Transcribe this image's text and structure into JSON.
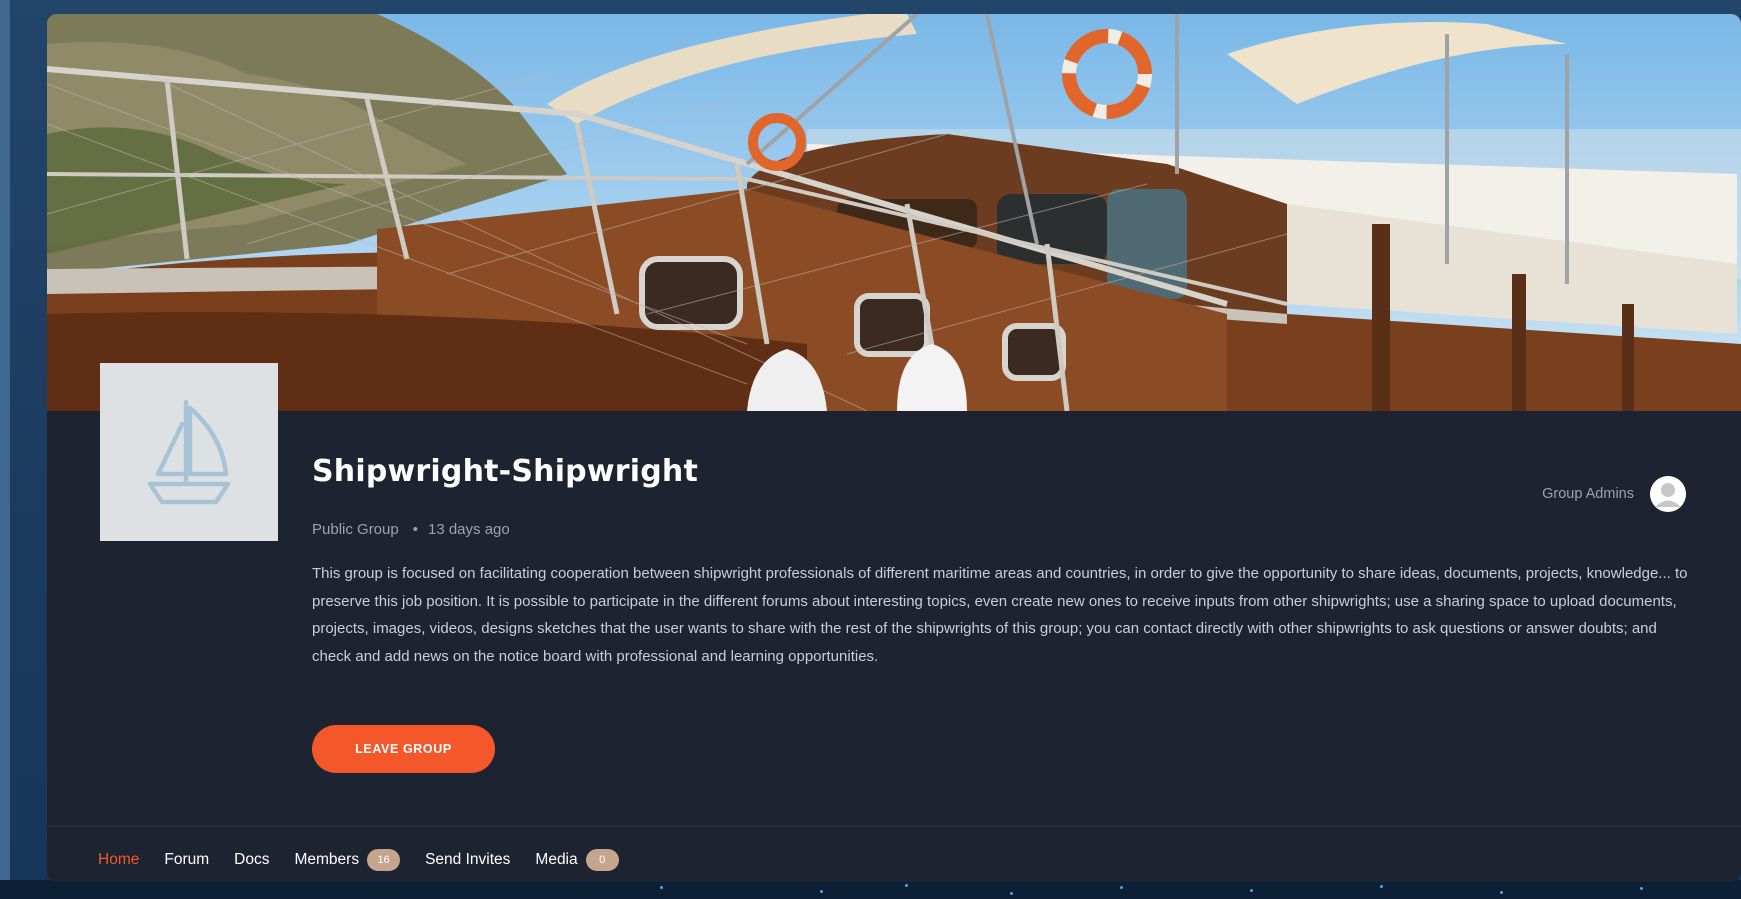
{
  "group": {
    "name": "Shipwright-Shipwright",
    "privacy": "Public Group",
    "separator": "•",
    "age": "13 days ago",
    "description": "This group is focused on facilitating cooperation between shipwright professionals of different maritime areas and countries, in order to give the opportunity to share ideas, documents, projects, knowledge... to preserve this job position. It is possible to participate in the different forums about interesting topics, even create new ones to receive inputs from other shipwrights; use a sharing space to upload documents, projects, images, videos, designs sketches that the user wants to share with the rest of the shipwrights of this group; you can contact directly with other shipwrights to ask questions or answer doubts; and check and add news on the notice board with professional and learning opportunities.",
    "leave_label": "LEAVE GROUP",
    "admins_label": "Group Admins"
  },
  "nav": {
    "items": [
      {
        "label": "Home",
        "active": true
      },
      {
        "label": "Forum"
      },
      {
        "label": "Docs"
      },
      {
        "label": "Members",
        "count": "16"
      },
      {
        "label": "Send Invites"
      },
      {
        "label": "Media",
        "count": "0"
      }
    ]
  },
  "colors": {
    "accent": "#f4582a",
    "card_bg": "#1d2330",
    "page_bg": "#1b3a5e",
    "badge": "#c6a58e"
  },
  "icons": {
    "avatar": "sailboat-icon",
    "admin": "user-avatar-icon"
  }
}
